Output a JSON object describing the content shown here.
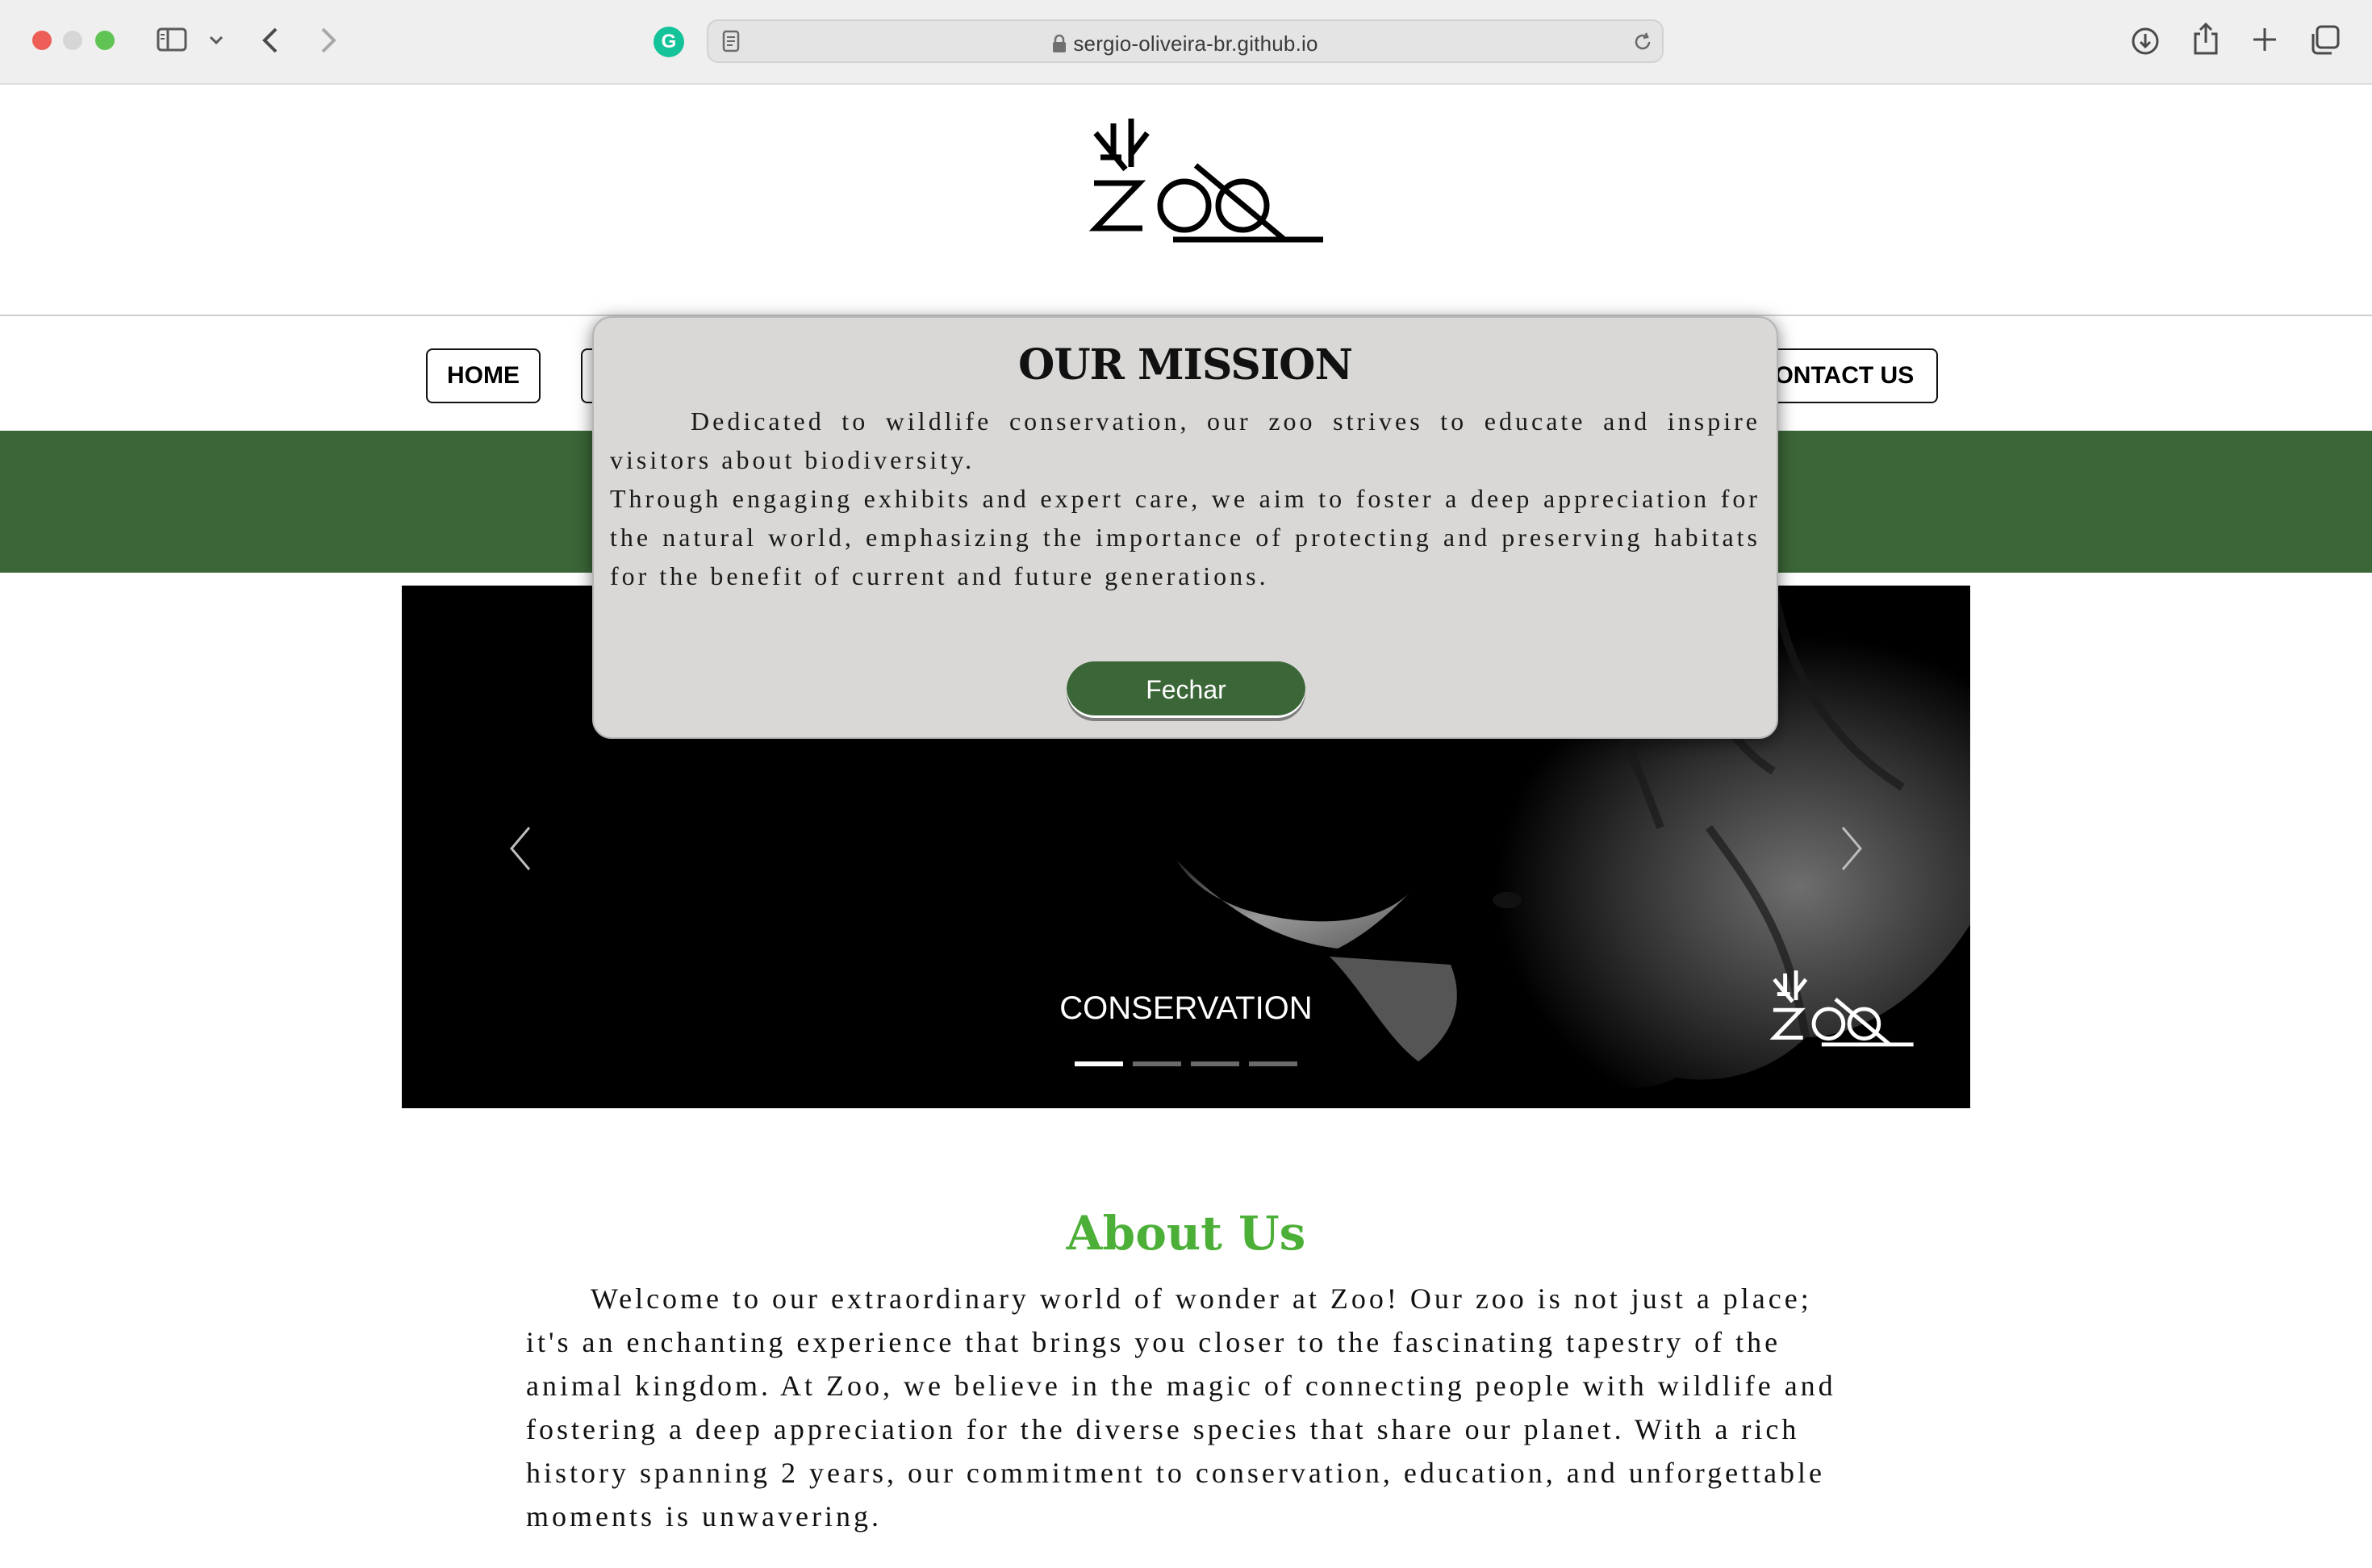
{
  "browser": {
    "url": "sergio-oliveira-br.github.io",
    "grammarly_letter": "G"
  },
  "nav": {
    "home": "HOME",
    "contact": "CONTACT US"
  },
  "carousel": {
    "caption": "CONSERVATION",
    "logo_text": "ZOO",
    "slide_count": 4,
    "active_slide": 1
  },
  "logo": {
    "text": "ZOO"
  },
  "about": {
    "title": "About Us",
    "text": "Welcome to our extraordinary world of wonder at Zoo! Our zoo is not just a place; it's an enchanting experience that brings you closer to the fascinating tapestry of the animal kingdom. At Zoo, we believe in the magic of connecting people with wildlife and fostering a deep appreciation for the diverse species that share our planet. With a rich history spanning 2 years, our commitment to conservation, education, and unforgettable moments is unwavering."
  },
  "modal": {
    "title": "OUR MISSION",
    "paragraph1": "Dedicated to wildlife conservation, our zoo strives to educate and inspire visitors about biodiversity.",
    "paragraph2": "Through engaging exhibits and expert care, we aim to foster a deep appreciation for the natural world, emphasizing the importance of protecting and preserving habitats for the benefit of current and future generations.",
    "close_label": "Fechar"
  },
  "colors": {
    "brand_green": "#3b6638",
    "about_title_green": "#4caf37",
    "modal_bg": "#d9d8d6"
  }
}
